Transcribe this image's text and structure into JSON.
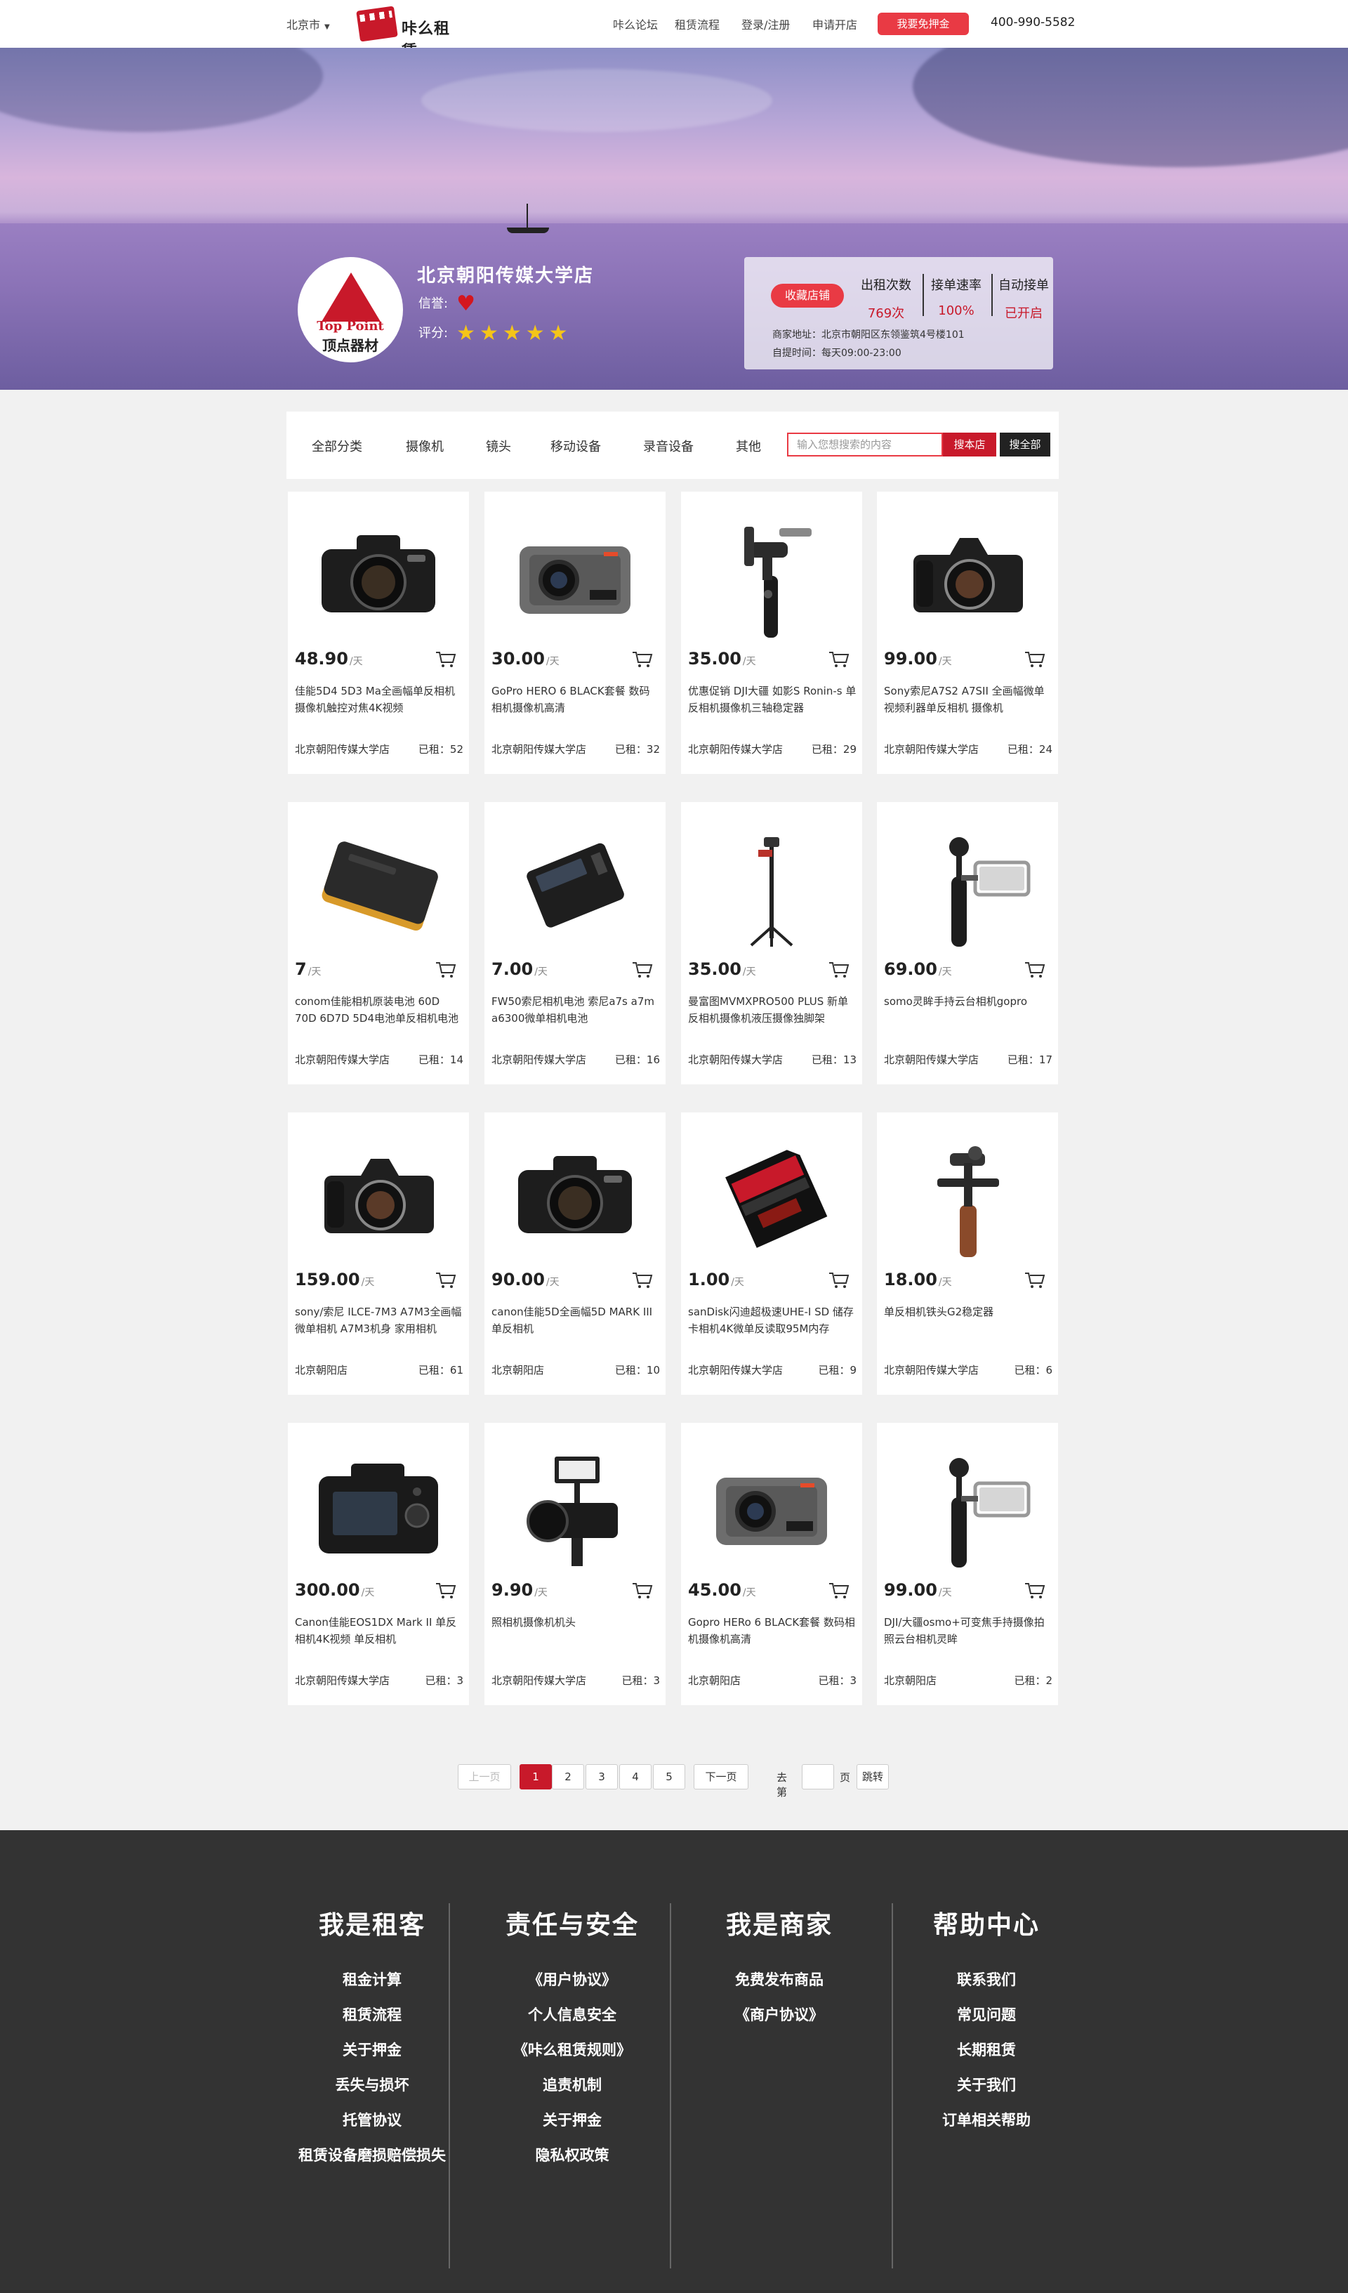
{
  "topbar": {
    "city": "北京市",
    "logo_text": "咔么租赁",
    "nav": [
      "咔么论坛",
      "租赁流程",
      "登录/注册",
      "申请开店"
    ],
    "cta": "我要免押金",
    "phone": "400-990-5582"
  },
  "shop": {
    "logo_en": "Top Point",
    "logo_cn": "顶点器材",
    "name": "北京朝阳传媒大学店",
    "credit_label": "信誉:",
    "rating_label": "评分:",
    "rating_stars": 5,
    "fav_button": "收藏店铺",
    "stats": [
      {
        "label": "出租次数",
        "value": "769次"
      },
      {
        "label": "接单速率",
        "value": "100%"
      },
      {
        "label": "自动接单",
        "value": "已开启"
      }
    ],
    "address": "商家地址：北京市朝阳区东领鉴筑4号楼101",
    "hours": "自提时间：每天09:00-23:00"
  },
  "filter": {
    "categories": [
      "全部分类",
      "摄像机",
      "镜头",
      "移动设备",
      "录音设备",
      "其他"
    ],
    "search_placeholder": "输入您想搜索的内容",
    "search_shop": "搜本店",
    "search_all": "搜全部"
  },
  "price_unit": "/天",
  "products": [
    {
      "price": "48.90",
      "title": "佳能5D4 5D3 Ma全画幅单反相机摄像机触控对焦4K视频",
      "shop": "北京朝阳传媒大学店",
      "rented": "已租：52",
      "icon": "dslr-camera"
    },
    {
      "price": "30.00",
      "title": "GoPro HERO 6 BLACK套餐 数码相机摄像机高清",
      "shop": "北京朝阳传媒大学店",
      "rented": "已租：32",
      "icon": "action-camera"
    },
    {
      "price": "35.00",
      "title": "优惠促销 DJI大疆 如影S Ronin-s 单反相机摄像机三轴稳定器",
      "shop": "北京朝阳传媒大学店",
      "rented": "已租：29",
      "icon": "gimbal"
    },
    {
      "price": "99.00",
      "title": "Sony索尼A7S2 A7SII 全画幅微单视频利器单反相机 摄像机",
      "shop": "北京朝阳传媒大学店",
      "rented": "已租：24",
      "icon": "mirrorless-camera"
    },
    {
      "price": "7",
      "title": "conom佳能相机原装电池 60D 70D 6D7D 5D4电池单反相机电池",
      "shop": "北京朝阳传媒大学店",
      "rented": "已租：14",
      "icon": "battery"
    },
    {
      "price": "7.00",
      "title": "FW50索尼相机电池 索尼a7s a7m a6300微单相机电池",
      "shop": "北京朝阳传媒大学店",
      "rented": "已租：16",
      "icon": "battery-dark"
    },
    {
      "price": "35.00",
      "title": "曼富图MVMXPRO500 PLUS 新单反相机摄像机液压摄像独脚架",
      "shop": "北京朝阳传媒大学店",
      "rented": "已租：13",
      "icon": "monopod"
    },
    {
      "price": "69.00",
      "title": "somo灵眸手持云台相机gopro",
      "shop": "北京朝阳传媒大学店",
      "rented": "已租：17",
      "icon": "handheld-gimbal"
    },
    {
      "price": "159.00",
      "title": "sony/索尼 ILCE-7M3 A7M3全画幅微单相机 A7M3机身 家用相机",
      "shop": "北京朝阳店",
      "rented": "已租：61",
      "icon": "mirrorless-camera"
    },
    {
      "price": "90.00",
      "title": "canon佳能5D全画幅5D MARK III 单反相机",
      "shop": "北京朝阳店",
      "rented": "已租：10",
      "icon": "dslr-camera"
    },
    {
      "price": "1.00",
      "title": "sanDisk闪迪超极速UHE-I SD 储存卡相机4K微单反读取95M内存",
      "shop": "北京朝阳传媒大学店",
      "rented": "已租：9",
      "icon": "sd-card"
    },
    {
      "price": "18.00",
      "title": "单反相机铁头G2稳定器",
      "shop": "北京朝阳传媒大学店",
      "rented": "已租：6",
      "icon": "stabilizer"
    },
    {
      "price": "300.00",
      "title": "Canon佳能EOS1DX Mark II 单反相机4K视频 单反相机",
      "shop": "北京朝阳传媒大学店",
      "rented": "已租：3",
      "icon": "dslr-back"
    },
    {
      "price": "9.90",
      "title": "照相机摄像机机头",
      "shop": "北京朝阳传媒大学店",
      "rented": "已租：3",
      "icon": "camera-rig"
    },
    {
      "price": "45.00",
      "title": "Gopro HERo 6 BLACK套餐 数码相机摄像机高清",
      "shop": "北京朝阳店",
      "rented": "已租：3",
      "icon": "action-camera"
    },
    {
      "price": "99.00",
      "title": "DJI/大疆osmo+可变焦手持摄像拍照云台相机灵眸",
      "shop": "北京朝阳店",
      "rented": "已租：2",
      "icon": "handheld-gimbal"
    }
  ],
  "pagination": {
    "prev": "上一页",
    "pages": [
      "1",
      "2",
      "3",
      "4",
      "5"
    ],
    "current": "1",
    "next": "下一页",
    "goto_prefix": "去第",
    "goto_suffix": "页",
    "goto_button": "跳转"
  },
  "footer": {
    "columns": [
      {
        "title": "我是租客",
        "links": [
          "租金计算",
          "租赁流程",
          "关于押金",
          "丢失与损坏",
          "托管协议",
          "租赁设备磨损赔偿损失"
        ]
      },
      {
        "title": "责任与安全",
        "links": [
          "《用户协议》",
          "个人信息安全",
          "《咔么租赁规则》",
          "追责机制",
          "关于押金",
          "隐私权政策"
        ]
      },
      {
        "title": "我是商家",
        "links": [
          "免费发布商品",
          "《商户协议》"
        ]
      },
      {
        "title": "帮助中心",
        "links": [
          "联系我们",
          "常见问题",
          "长期租赁",
          "关于我们",
          "订单相关帮助"
        ]
      }
    ]
  }
}
